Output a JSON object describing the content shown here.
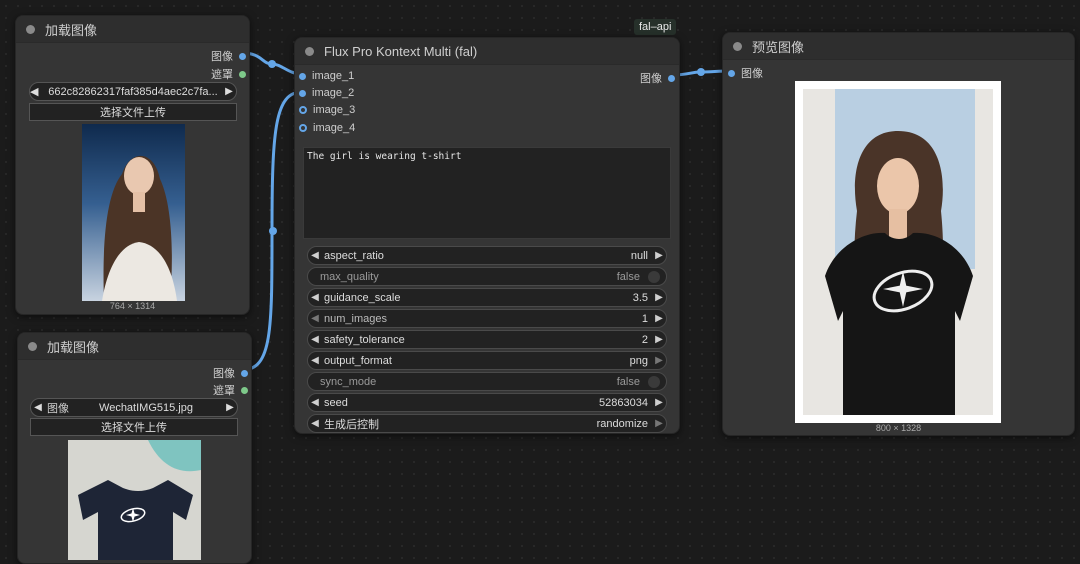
{
  "load_image_1": {
    "title": "加载图像",
    "output_image": "图像",
    "output_mask": "遮罩",
    "filename": "662c82862317faf385d4aec2c7fa...",
    "upload_label": "选择文件上传",
    "dimensions": "764 × 1314"
  },
  "load_image_2": {
    "title": "加载图像",
    "output_image": "图像",
    "output_mask": "遮罩",
    "file_label": "图像",
    "filename": "WechatIMG515.jpg",
    "upload_label": "选择文件上传"
  },
  "flux_node": {
    "badge": "fal–api",
    "title": "Flux Pro Kontext Multi (fal)",
    "output_image": "图像",
    "inputs": [
      "image_1",
      "image_2",
      "image_3",
      "image_4"
    ],
    "prompt": "The girl is wearing t-shirt",
    "widgets": [
      {
        "label": "aspect_ratio",
        "value": "null"
      },
      {
        "label": "max_quality",
        "value": "false"
      },
      {
        "label": "guidance_scale",
        "value": "3.5"
      },
      {
        "label": "num_images",
        "value": "1"
      },
      {
        "label": "safety_tolerance",
        "value": "2"
      },
      {
        "label": "output_format",
        "value": "png"
      },
      {
        "label": "sync_mode",
        "value": "false"
      },
      {
        "label": "seed",
        "value": "52863034"
      },
      {
        "label": "生成后控制",
        "value": "randomize"
      }
    ]
  },
  "preview_node": {
    "title": "预览图像",
    "input_image": "图像",
    "dimensions": "800 × 1328"
  }
}
